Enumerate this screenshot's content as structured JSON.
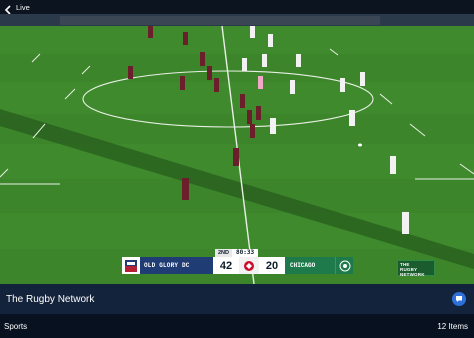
{
  "topbar": {
    "back_label": "Live"
  },
  "video": {
    "scoreboard": {
      "period": "2ND",
      "clock": "80:33",
      "home_name": "OLD GLORY DC",
      "home_score": "42",
      "away_name": "CHICAGO",
      "away_score": "20"
    },
    "watermark": {
      "line1": "THE",
      "line2": "RUGBY",
      "line3": "NETWORK"
    }
  },
  "info": {
    "title": "The Rugby Network"
  },
  "footer": {
    "category": "Sports",
    "count": "12 Items"
  },
  "colors": {
    "pitch": "#3f8a2d",
    "home_team": "#1f3c74",
    "away_team": "#1e7a4a",
    "accent": "#2f6fd8",
    "panel": "#13233b"
  }
}
